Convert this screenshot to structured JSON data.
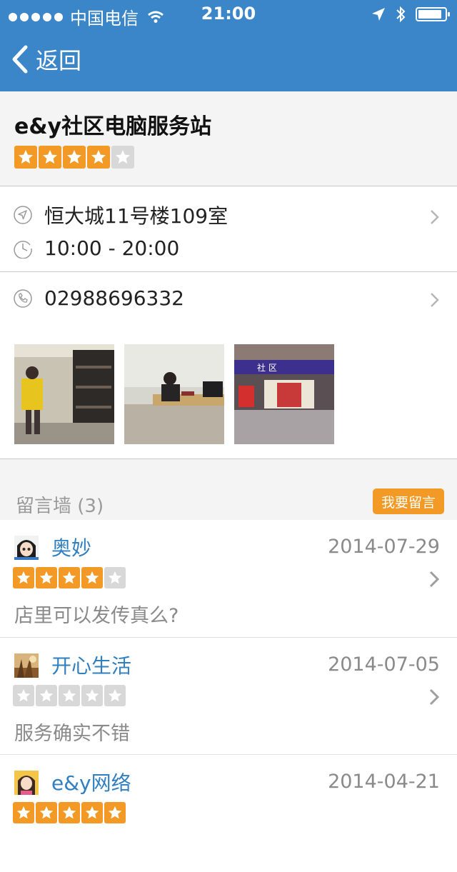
{
  "status_bar": {
    "carrier": "中国电信",
    "time": "21:00",
    "signal_dots": 5,
    "battery_level": 0.9
  },
  "nav": {
    "back_label": "返回"
  },
  "store": {
    "name": "e&y社区电脑服务站",
    "rating": 4,
    "address": "恒大城11号楼109室",
    "hours": "10:00 - 20:00",
    "phone": "02988696332"
  },
  "photos": [
    "shop-interior-photo-1",
    "shop-interior-photo-2",
    "shop-storefront-photo"
  ],
  "wall": {
    "title": "留言墙 (3)",
    "leave_message_label": "我要留言",
    "comments": [
      {
        "user": "奥妙",
        "date": "2014-07-29",
        "rating": 4,
        "text": "店里可以发传真么?"
      },
      {
        "user": "开心生活",
        "date": "2014-07-05",
        "rating": 0,
        "text": "服务确实不错"
      },
      {
        "user": "e&y网络",
        "date": "2014-04-21",
        "rating": 5,
        "text": ""
      }
    ]
  },
  "colors": {
    "header": "#3a86c8",
    "accent": "#f29a25",
    "link": "#2f7fc1"
  }
}
